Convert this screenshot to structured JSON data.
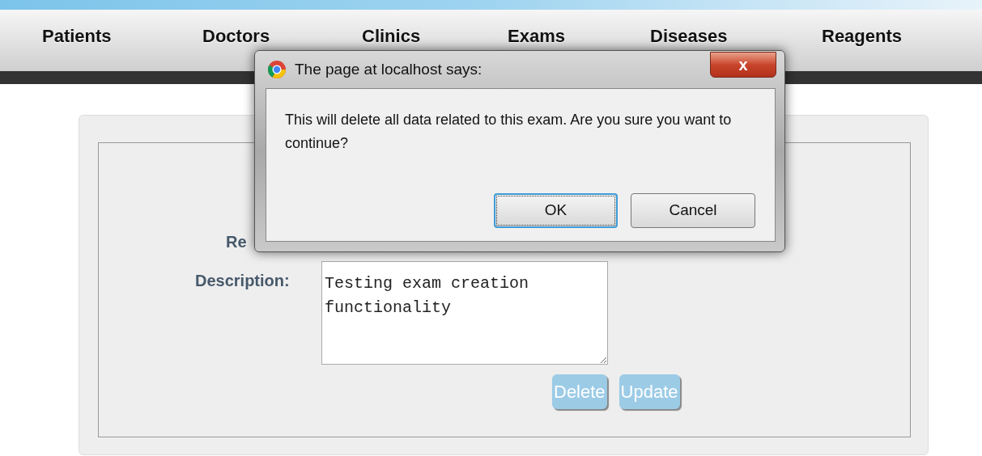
{
  "nav": {
    "items": [
      {
        "label": "Patients"
      },
      {
        "label": "Doctors"
      },
      {
        "label": "Clinics"
      },
      {
        "label": "Exams"
      },
      {
        "label": "Diseases"
      },
      {
        "label": "Reagents"
      }
    ]
  },
  "form": {
    "partial_label": "Re",
    "description_label": "Description:",
    "description_value": "Testing exam creation functionality",
    "buttons": [
      {
        "label": "Delete"
      },
      {
        "label": "Update"
      }
    ]
  },
  "dialog": {
    "title": "The page at localhost says:",
    "close": "x",
    "message": "This will delete all data related to this exam. Are you sure you want to continue?",
    "buttons": [
      {
        "label": "OK",
        "focused": true
      },
      {
        "label": "Cancel",
        "focused": false
      }
    ]
  }
}
